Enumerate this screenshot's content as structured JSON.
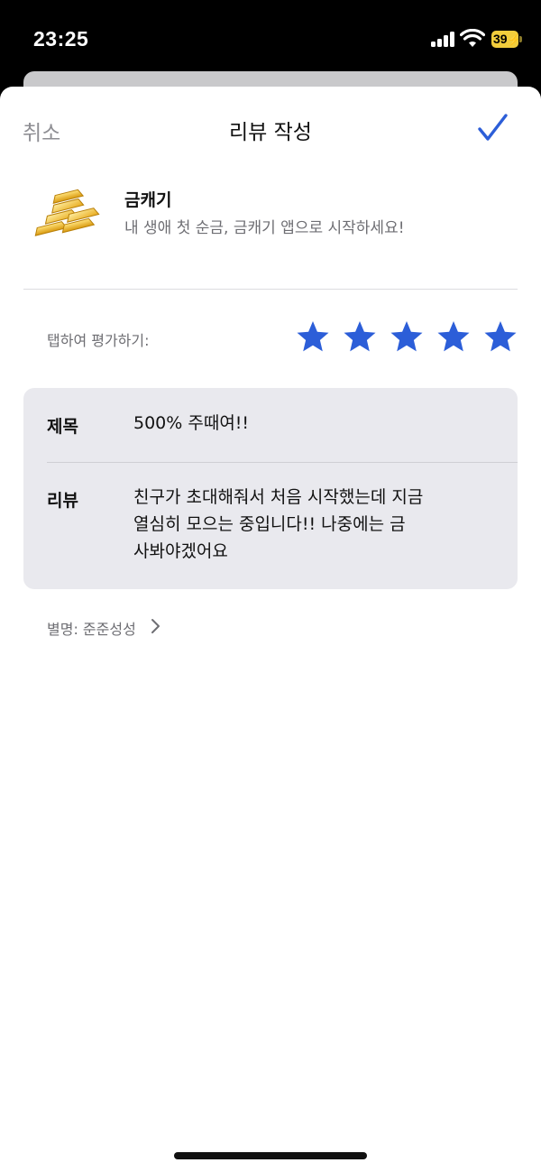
{
  "status_bar": {
    "time": "23:25",
    "battery": "39"
  },
  "nav": {
    "cancel_label": "취소",
    "title": "리뷰 작성",
    "done_icon": "checkmark-icon"
  },
  "app": {
    "name": "금캐기",
    "subtitle": "내 생애 첫 순금, 금캐기 앱으로 시작하세요!",
    "icon": "gold-bars-icon"
  },
  "rating": {
    "label": "탭하여 평가하기:",
    "value": 5,
    "max": 5,
    "color": "#2c5ed8"
  },
  "review": {
    "title_label": "제목",
    "title_value": "500% 주때여!!",
    "body_label": "리뷰",
    "body_lines": [
      "친구가 초대해줘서 처음 시작했는데 지금",
      "열심히 모으는 중입니다!! 나중에는 금",
      "사봐야겠어요"
    ]
  },
  "nickname": {
    "text": "별명: 준준성성"
  }
}
